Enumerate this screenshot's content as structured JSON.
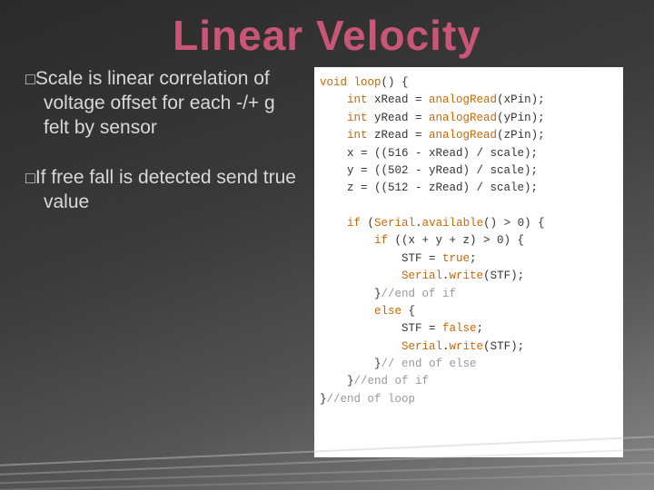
{
  "title": "Linear Velocity",
  "bullets": [
    "Scale is linear correlation of voltage offset for each -/+ g felt by sensor",
    "If free fall is detected send true value"
  ],
  "code": {
    "lines": [
      {
        "indent": 0,
        "tokens": [
          {
            "t": "void ",
            "c": "kw"
          },
          {
            "t": "loop",
            "c": "fn"
          },
          {
            "t": "() {",
            "c": "var"
          }
        ]
      },
      {
        "indent": 1,
        "tokens": [
          {
            "t": "int ",
            "c": "kw"
          },
          {
            "t": "xRead = ",
            "c": "var"
          },
          {
            "t": "analogRead",
            "c": "fn"
          },
          {
            "t": "(xPin);",
            "c": "var"
          }
        ]
      },
      {
        "indent": 1,
        "tokens": [
          {
            "t": "int ",
            "c": "kw"
          },
          {
            "t": "yRead = ",
            "c": "var"
          },
          {
            "t": "analogRead",
            "c": "fn"
          },
          {
            "t": "(yPin);",
            "c": "var"
          }
        ]
      },
      {
        "indent": 1,
        "tokens": [
          {
            "t": "int ",
            "c": "kw"
          },
          {
            "t": "zRead = ",
            "c": "var"
          },
          {
            "t": "analogRead",
            "c": "fn"
          },
          {
            "t": "(zPin);",
            "c": "var"
          }
        ]
      },
      {
        "indent": 1,
        "tokens": [
          {
            "t": "x = ((516 - xRead) / scale);",
            "c": "var"
          }
        ]
      },
      {
        "indent": 1,
        "tokens": [
          {
            "t": "y = ((502 - yRead) / scale);",
            "c": "var"
          }
        ]
      },
      {
        "indent": 1,
        "tokens": [
          {
            "t": "z = ((512 - zRead) / scale);",
            "c": "var"
          }
        ]
      },
      {
        "indent": 0,
        "tokens": [
          {
            "t": "",
            "c": "var"
          }
        ]
      },
      {
        "indent": 1,
        "tokens": [
          {
            "t": "if ",
            "c": "kw"
          },
          {
            "t": "(",
            "c": "var"
          },
          {
            "t": "Serial",
            "c": "fn"
          },
          {
            "t": ".",
            "c": "var"
          },
          {
            "t": "available",
            "c": "fn"
          },
          {
            "t": "() > 0) {",
            "c": "var"
          }
        ]
      },
      {
        "indent": 2,
        "tokens": [
          {
            "t": "if ",
            "c": "kw"
          },
          {
            "t": "((x + y + z) > 0) {",
            "c": "var"
          }
        ]
      },
      {
        "indent": 3,
        "tokens": [
          {
            "t": "STF = ",
            "c": "var"
          },
          {
            "t": "true",
            "c": "kw"
          },
          {
            "t": ";",
            "c": "var"
          }
        ]
      },
      {
        "indent": 3,
        "tokens": [
          {
            "t": "Serial",
            "c": "fn"
          },
          {
            "t": ".",
            "c": "var"
          },
          {
            "t": "write",
            "c": "fn"
          },
          {
            "t": "(STF);",
            "c": "var"
          }
        ]
      },
      {
        "indent": 2,
        "tokens": [
          {
            "t": "}",
            "c": "var"
          },
          {
            "t": "//end of if",
            "c": "comment"
          }
        ]
      },
      {
        "indent": 2,
        "tokens": [
          {
            "t": "else ",
            "c": "kw"
          },
          {
            "t": "{",
            "c": "var"
          }
        ]
      },
      {
        "indent": 3,
        "tokens": [
          {
            "t": "STF = ",
            "c": "var"
          },
          {
            "t": "false",
            "c": "kw"
          },
          {
            "t": ";",
            "c": "var"
          }
        ]
      },
      {
        "indent": 3,
        "tokens": [
          {
            "t": "Serial",
            "c": "fn"
          },
          {
            "t": ".",
            "c": "var"
          },
          {
            "t": "write",
            "c": "fn"
          },
          {
            "t": "(STF);",
            "c": "var"
          }
        ]
      },
      {
        "indent": 2,
        "tokens": [
          {
            "t": "}",
            "c": "var"
          },
          {
            "t": "// end of else",
            "c": "comment"
          }
        ]
      },
      {
        "indent": 1,
        "tokens": [
          {
            "t": "}",
            "c": "var"
          },
          {
            "t": "//end of if",
            "c": "comment"
          }
        ]
      },
      {
        "indent": 0,
        "tokens": [
          {
            "t": "}",
            "c": "var"
          },
          {
            "t": "//end of loop",
            "c": "comment"
          }
        ]
      }
    ]
  }
}
